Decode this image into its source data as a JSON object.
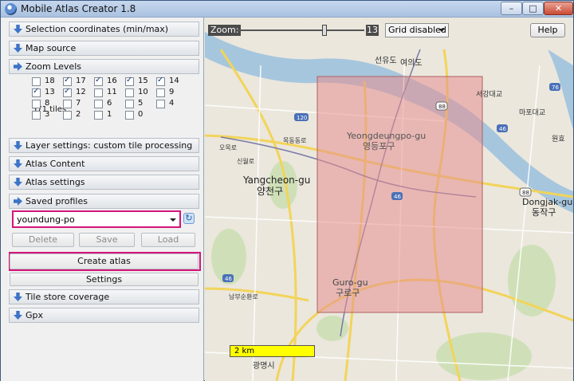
{
  "window": {
    "title": "Mobile Atlas Creator 1.8",
    "controls": {
      "minimize": "–",
      "maximize": "□",
      "close": "✕"
    }
  },
  "left_panel": {
    "sections": [
      {
        "label": "Selection coordinates (min/max)",
        "expanded": false
      },
      {
        "label": "Map source",
        "expanded": false
      },
      {
        "label": "Zoom Levels",
        "expanded": true
      },
      {
        "label": "Layer settings: custom tile processing",
        "expanded": false
      },
      {
        "label": "Atlas Content",
        "expanded": false
      },
      {
        "label": "Atlas settings",
        "expanded": false
      },
      {
        "label": "Saved profiles",
        "expanded": true
      },
      {
        "label": "Tile store coverage",
        "expanded": false
      },
      {
        "label": "Gpx",
        "expanded": false
      }
    ],
    "zoom_levels": [
      {
        "level": "18",
        "checked": false
      },
      {
        "level": "17",
        "checked": true
      },
      {
        "level": "16",
        "checked": true
      },
      {
        "level": "15",
        "checked": true
      },
      {
        "level": "14",
        "checked": true
      },
      {
        "level": "13",
        "checked": true
      },
      {
        "level": "12",
        "checked": true
      },
      {
        "level": "11",
        "checked": false
      },
      {
        "level": "10",
        "checked": false
      },
      {
        "level": "9",
        "checked": false
      },
      {
        "level": "8",
        "checked": false
      },
      {
        "level": "7",
        "checked": false
      },
      {
        "level": "6",
        "checked": false
      },
      {
        "level": "5",
        "checked": false
      },
      {
        "level": "4",
        "checked": false
      },
      {
        "level": "3",
        "checked": false
      },
      {
        "level": "2",
        "checked": false
      },
      {
        "level": "1",
        "checked": false
      },
      {
        "level": "0",
        "checked": false
      }
    ],
    "tile_count": "571 tiles",
    "saved_profile": {
      "value": "youndung-po"
    },
    "profile_buttons": {
      "delete": "Delete",
      "save": "Save",
      "load": "Load"
    },
    "create_atlas": "Create atlas",
    "settings": "Settings"
  },
  "map_toolbar": {
    "zoom_label": "Zoom:",
    "zoom_value": "13",
    "grid": "Grid disabled",
    "help": "Help",
    "scale": "2 km"
  },
  "map_labels": [
    {
      "text": "선유도",
      "c": "#333"
    },
    {
      "text": "여의도",
      "c": "#333"
    },
    {
      "text": "Yeongdeungpo-gu",
      "c": "#555"
    },
    {
      "text": "영등포구",
      "c": "#555"
    },
    {
      "text": "Yangcheon-gu",
      "c": "#222"
    },
    {
      "text": "양천구",
      "c": "#222"
    },
    {
      "text": "Guro-gu",
      "c": "#444"
    },
    {
      "text": "구로구",
      "c": "#444"
    },
    {
      "text": "Dongjak-gu",
      "c": "#222"
    },
    {
      "text": "동작구",
      "c": "#222"
    },
    {
      "text": "광명시",
      "c": "#333"
    },
    {
      "text": "마포대교",
      "c": "#333"
    },
    {
      "text": "서강대교",
      "c": "#333"
    },
    {
      "text": "원효",
      "c": "#333"
    },
    {
      "text": "오목로",
      "c": "#333"
    },
    {
      "text": "목동동로",
      "c": "#333"
    },
    {
      "text": "신월로",
      "c": "#333"
    },
    {
      "text": "남부순환로",
      "c": "#333"
    }
  ],
  "colors": {
    "highlight": "#d4157a",
    "selection": "#e4a0a4",
    "river": "#a6c6dd"
  }
}
